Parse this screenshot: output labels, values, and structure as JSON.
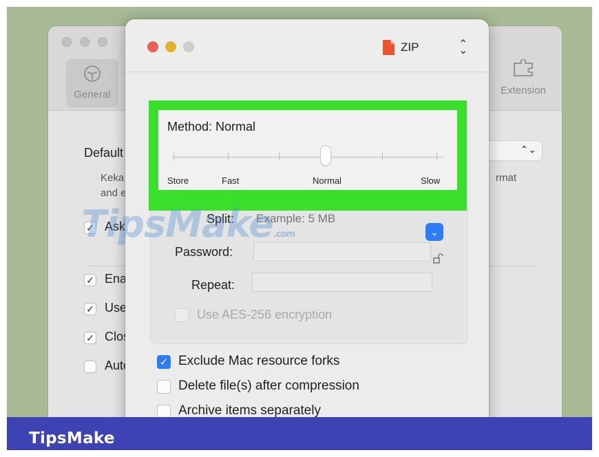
{
  "brand": "TipsMake",
  "watermark": {
    "text": "TipsMake",
    "suffix": ".com"
  },
  "back_window": {
    "toolbar": {
      "general": "General",
      "extension": "Extension"
    },
    "default_label": "Default",
    "desc_line1": "Keka",
    "desc_line2": "and e",
    "format_right": "rmat",
    "checkboxes": [
      {
        "label": "Ask",
        "checked": true
      },
      {
        "label": "Ena",
        "checked": true
      },
      {
        "label": "Use",
        "checked": true
      },
      {
        "label": "Clos",
        "checked": true
      },
      {
        "label": "Auto",
        "checked": false
      }
    ]
  },
  "keka_window": {
    "format": "ZIP",
    "method": {
      "title": "Method: Normal",
      "labels": [
        "Store",
        "Fast",
        "Normal",
        "Slow"
      ],
      "selected": "Normal"
    },
    "split": {
      "label": "Split:",
      "placeholder": "Example: 5 MB"
    },
    "password": {
      "label": "Password:",
      "value": ""
    },
    "repeat": {
      "label": "Repeat:",
      "value": ""
    },
    "aes_label": "Use AES-256 encryption",
    "options": [
      {
        "label": "Exclude Mac resource forks",
        "checked": true
      },
      {
        "label": "Delete file(s) after compression",
        "checked": false
      },
      {
        "label": "Archive items separately",
        "checked": false
      }
    ]
  },
  "colors": {
    "highlight": "#39df2a",
    "frame": "#3d43b3",
    "accent": "#2d7cf6"
  }
}
